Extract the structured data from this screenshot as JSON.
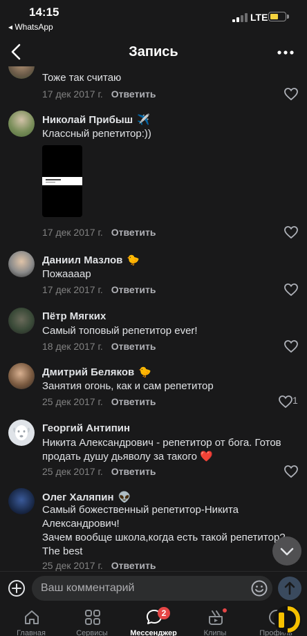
{
  "status_bar": {
    "time": "14:15",
    "back_app": "◂ WhatsApp",
    "network": "LTE",
    "battery_level": 0.45
  },
  "header": {
    "title": "Запись"
  },
  "reply_label": "Ответить",
  "comments": [
    {
      "author": "",
      "text": "Тоже так считаю",
      "date": "17 дек 2017 г.",
      "likes": ""
    },
    {
      "author": "Николай Прибыш",
      "author_emoji": "✈️",
      "text": "Классный репетитор:))",
      "has_attachment": true,
      "date": "17 дек 2017 г.",
      "likes": ""
    },
    {
      "author": "Даниил Мазлов",
      "author_emoji": "🐤",
      "text": "Пожааааp",
      "date": "17 дек 2017 г.",
      "likes": ""
    },
    {
      "author": "Пётр Мягких",
      "text": "Самый топовый репетитор ever!",
      "date": "18 дек 2017 г.",
      "likes": ""
    },
    {
      "author": "Дмитрий Беляков",
      "author_emoji": "🐤",
      "text": "Занятия огонь, как и сам репетитор",
      "date": "25 дек 2017 г.",
      "likes": "1"
    },
    {
      "author": "Георгий Антипин",
      "text_lines": [
        "Никита Александрович - репетитор от бога. Готов",
        "продать душу дьяволу за такого ❤️"
      ],
      "date": "25 дек 2017 г.",
      "likes": ""
    },
    {
      "author": "Олег Халяпин",
      "author_emoji": "👽",
      "text_lines": [
        "Самый божественный репетитор-Никита",
        "Александрович!",
        "Зачем вообще школа,когда есть такой репетитор?",
        "The best"
      ],
      "date": "25 дек 2017 г.",
      "likes": ""
    }
  ],
  "composer": {
    "placeholder": "Ваш комментарий"
  },
  "tabbar": {
    "tabs": [
      {
        "label": "Главная",
        "icon": "home-icon"
      },
      {
        "label": "Сервисы",
        "icon": "grid-icon"
      },
      {
        "label": "Мессенджер",
        "icon": "chat-icon",
        "active": true,
        "badge": "2"
      },
      {
        "label": "Клипы",
        "icon": "clips-icon"
      },
      {
        "label": "Профиль",
        "icon": "profile-icon"
      }
    ]
  },
  "colors": {
    "background": "#19191a",
    "text": "#e1e3e6",
    "secondary": "#828282",
    "badge": "#e64646",
    "battery": "#f5d33e"
  }
}
